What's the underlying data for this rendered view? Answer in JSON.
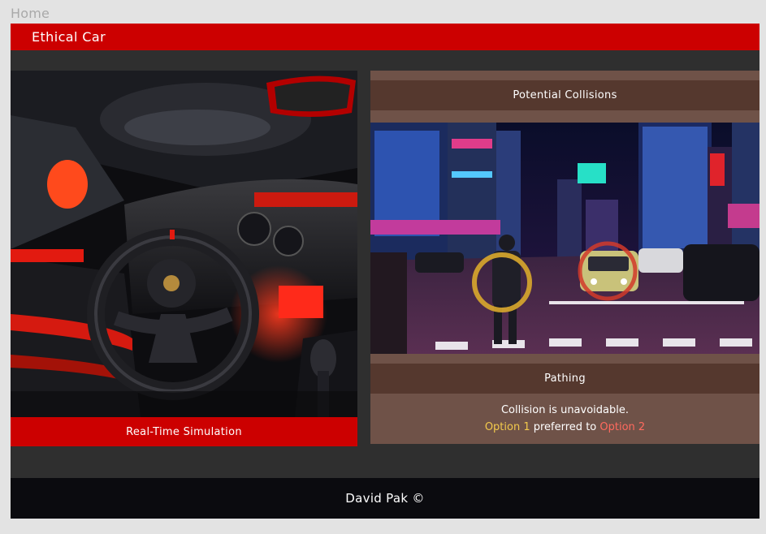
{
  "nav": {
    "home_label": "Home"
  },
  "header": {
    "title": "Ethical Car"
  },
  "simulation": {
    "label": "Real-Time Simulation",
    "image_subject": "sports car interior with steering wheel and red dashboard lighting"
  },
  "collisions": {
    "title": "Potential Collisions",
    "image_subject": "night city street crossing with pedestrian and taxi highlighted",
    "markers": [
      {
        "label": "pedestrian",
        "color": "#d9a92c"
      },
      {
        "label": "car",
        "color": "#d23a2a"
      }
    ]
  },
  "pathing": {
    "title": "Pathing",
    "line1": "Collision is unavoidable.",
    "option1": "Option 1",
    "middle": "preferred to",
    "option2": "Option 2"
  },
  "footer": {
    "credit": "David Pak ©"
  },
  "colors": {
    "brand_red": "#cc0000",
    "panel_brown": "#6f5248",
    "panel_header_brown": "#55382e",
    "option1": "#f2c94c",
    "option2": "#ff6a5e",
    "background": "#2f2f2f",
    "footer": "#0b0b0f"
  }
}
